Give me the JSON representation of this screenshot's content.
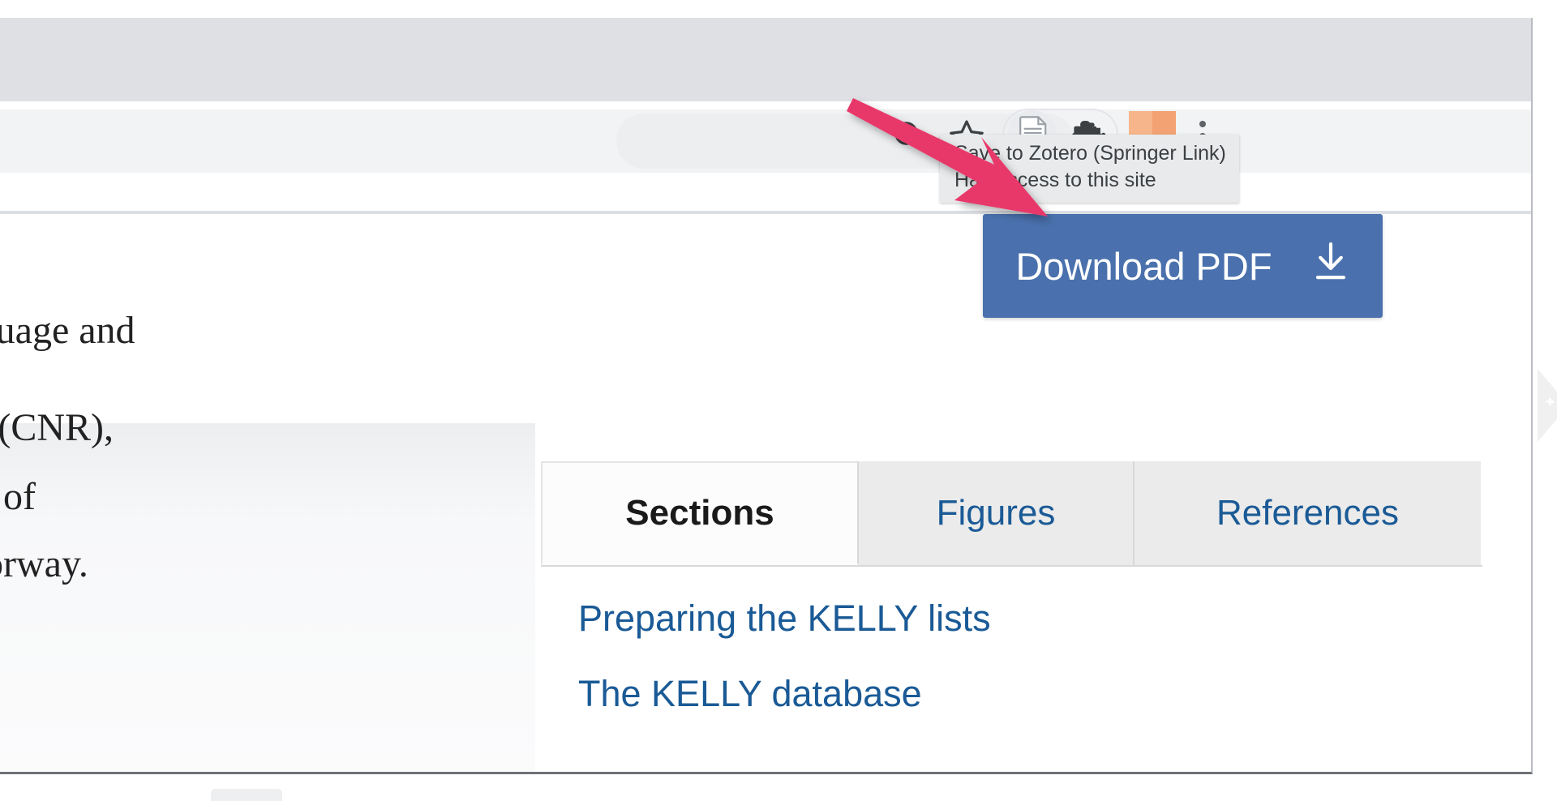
{
  "browser": {
    "toolbar": {
      "icons": [
        {
          "name": "zoom-in-icon",
          "label": "Zoom"
        },
        {
          "name": "bookmark-star-icon",
          "label": "Bookmark this tab"
        },
        {
          "name": "zotero-save-icon",
          "label": "Save to Zotero"
        },
        {
          "name": "extensions-puzzle-icon",
          "label": "Extensions"
        },
        {
          "name": "profile-avatar",
          "label": "Profile"
        },
        {
          "name": "chrome-menu-icon",
          "label": "Customize and control Google Chrome"
        }
      ]
    },
    "tooltip": {
      "line1": "Save to Zotero (Springer Link)",
      "line2": "Has access to this site"
    }
  },
  "page": {
    "download_button": {
      "label": "Download PDF",
      "icon": "download-arrow-icon"
    },
    "article_fragments": [
      "language and",
      "l (CNR),",
      "y of",
      "orway."
    ],
    "tabs": [
      {
        "label": "Sections",
        "active": true
      },
      {
        "label": "Figures",
        "active": false
      },
      {
        "label": "References",
        "active": false
      }
    ],
    "section_links": [
      "Preparing the KELLY lists",
      "The KELLY database"
    ]
  },
  "annotation": {
    "arrow": {
      "name": "pointer-arrow",
      "color": "#e8396a",
      "points_to": "zotero-save-icon"
    }
  },
  "colors": {
    "download_button_bg": "#4a71ad",
    "tab_link": "#1a5a96",
    "tooltip_bg": "#e9eaec",
    "arrow": "#e8396a",
    "tabstrip_bg": "#dee0e4",
    "toolbar_bg": "#f1f3f4"
  }
}
